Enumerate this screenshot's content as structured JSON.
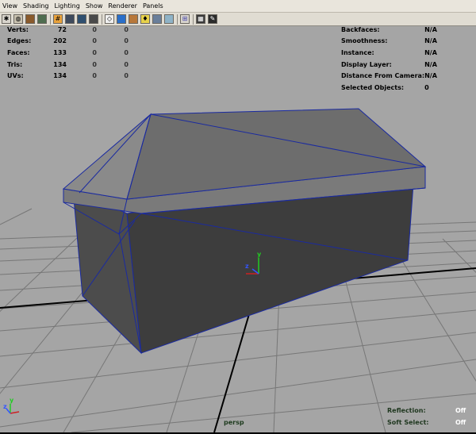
{
  "menu": [
    "View",
    "Shading",
    "Lighting",
    "Show",
    "Renderer",
    "Panels"
  ],
  "toolbar_icons": [
    "select-camera-icon",
    "camera-attributes-icon",
    "bookmark-icon",
    "image-plane-icon",
    "grid-icon",
    "film-gate-icon",
    "resolution-gate-icon",
    "safe-action-icon",
    "wireframe-icon",
    "smooth-shade-icon",
    "textured-icon",
    "lights-icon",
    "shadows-icon",
    "xray-icon",
    "isolate-icon",
    "high-quality-icon",
    "use-lights-icon"
  ],
  "hud_left": {
    "rows": [
      {
        "label": "Verts:",
        "v1": "72",
        "v2": "0",
        "v3": "0"
      },
      {
        "label": "Edges:",
        "v1": "202",
        "v2": "0",
        "v3": "0"
      },
      {
        "label": "Faces:",
        "v1": "133",
        "v2": "0",
        "v3": "0"
      },
      {
        "label": "Tris:",
        "v1": "134",
        "v2": "0",
        "v3": "0"
      },
      {
        "label": "UVs:",
        "v1": "134",
        "v2": "0",
        "v3": "0"
      }
    ]
  },
  "hud_right": {
    "rows": [
      {
        "label": "Backfaces:",
        "value": "N/A"
      },
      {
        "label": "Smoothness:",
        "value": "N/A"
      },
      {
        "label": "Instance:",
        "value": "N/A"
      },
      {
        "label": "Display Layer:",
        "value": "N/A"
      },
      {
        "label": "Distance From Camera:",
        "value": "N/A"
      },
      {
        "label": "Selected Objects:",
        "value": "0"
      }
    ]
  },
  "camera_name": "persp",
  "reflection": {
    "label": "Reflection:",
    "value": "Off"
  },
  "soft_select": {
    "label": "Soft Select:",
    "value": "Off"
  },
  "axes": {
    "x": "x",
    "y": "y",
    "z": "z"
  },
  "colors": {
    "viewport_background": "#a5a5a5",
    "grid": "#777777",
    "grid_center": "#000000",
    "wireframe": "#1a2aa0",
    "menubar": "#e9e5dc",
    "axis_x": "#cc2222",
    "axis_y": "#22cc22",
    "axis_z": "#3355ff"
  }
}
